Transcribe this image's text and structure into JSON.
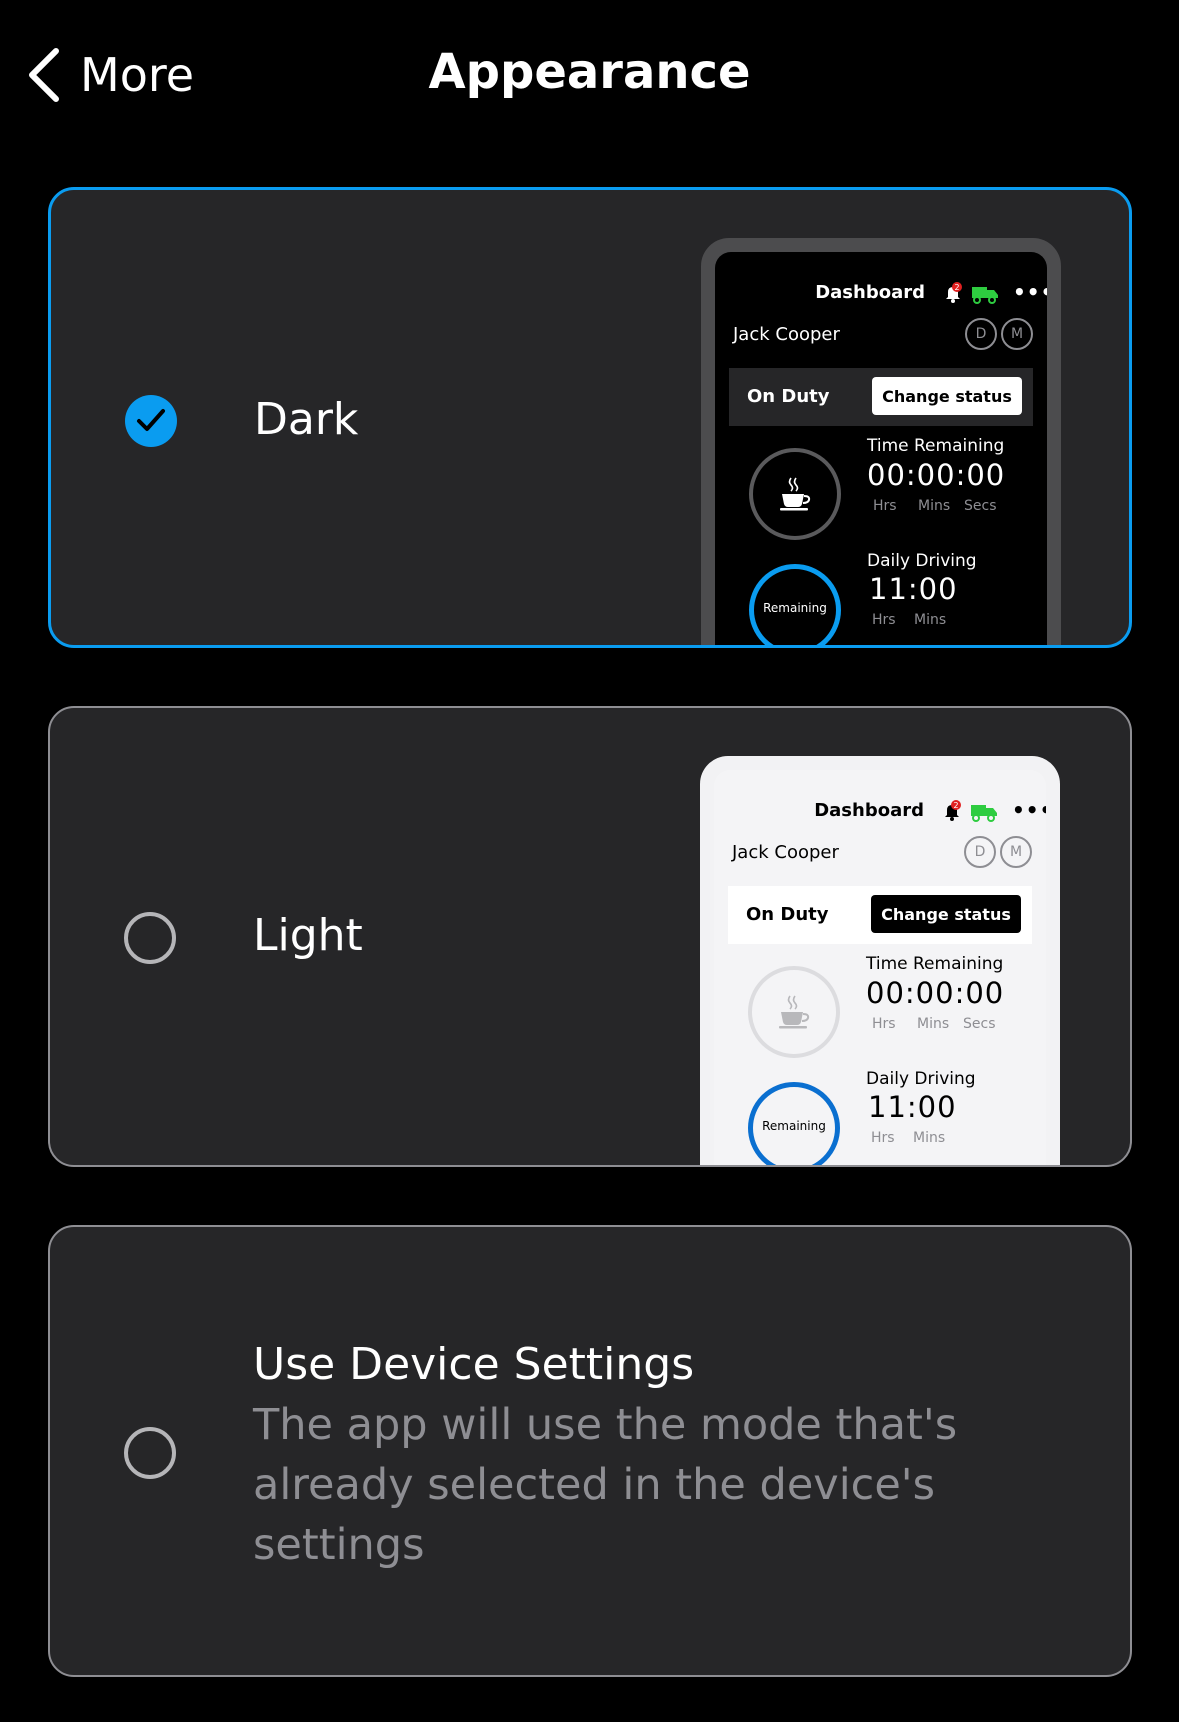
{
  "header": {
    "back_label": "More",
    "title": "Appearance"
  },
  "options": {
    "dark": {
      "label": "Dark",
      "selected": true
    },
    "light": {
      "label": "Light",
      "selected": false
    },
    "device": {
      "label": "Use Device Settings",
      "description": "The app will use the mode that's already selected in the device's settings",
      "selected": false
    }
  },
  "preview": {
    "title": "Dashboard",
    "notification_count": "2",
    "more": "•••",
    "driver_name": "Jack Cooper",
    "badge_d": "D",
    "badge_m": "M",
    "duty_status": "On Duty",
    "change_status": "Change status",
    "time_remaining_label": "Time Remaining",
    "time_remaining_value": "00:00:00",
    "unit_hrs": "Hrs",
    "unit_mins": "Mins",
    "unit_secs": "Secs",
    "ring_label": "Remaining",
    "daily_driving_label": "Daily Driving",
    "daily_driving_value": "11:00"
  },
  "colors": {
    "accent": "#0a9cf0",
    "card_bg": "#262628",
    "background": "#000000",
    "truck": "#2ecc40",
    "bell_badge": "#e02020"
  }
}
